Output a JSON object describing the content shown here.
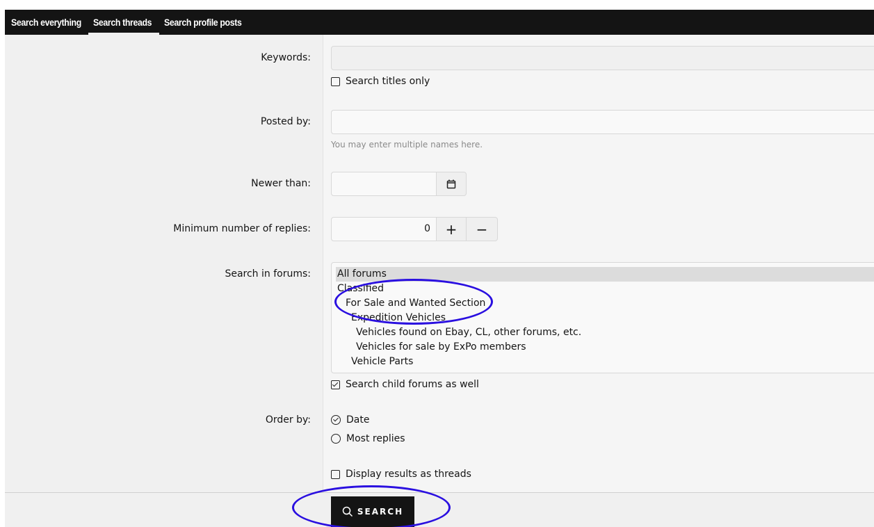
{
  "tabs": [
    {
      "label": "Search everything",
      "active": false
    },
    {
      "label": "Search threads",
      "active": true
    },
    {
      "label": "Search profile posts",
      "active": false
    }
  ],
  "form": {
    "keywords": {
      "label": "Keywords:",
      "value": "",
      "titles_only": {
        "label": "Search titles only",
        "checked": false
      }
    },
    "posted_by": {
      "label": "Posted by:",
      "value": "",
      "hint": "You may enter multiple names here."
    },
    "newer_than": {
      "label": "Newer than:",
      "value": "",
      "icon": "calendar-icon"
    },
    "min_replies": {
      "label": "Minimum number of replies:",
      "value": "0",
      "plus": "+",
      "minus": "−"
    },
    "forums": {
      "label": "Search in forums:",
      "options": [
        {
          "label": "All forums",
          "selected": true
        },
        {
          "label": "Classified",
          "selected": false
        },
        {
          "label": "For Sale and Wanted Section",
          "selected": false
        },
        {
          "label": "Expedition Vehicles",
          "selected": false
        },
        {
          "label": "Vehicles found on Ebay, CL, other forums, etc.",
          "selected": false
        },
        {
          "label": "Vehicles for sale by ExPo members",
          "selected": false
        },
        {
          "label": "Vehicle Parts",
          "selected": false
        }
      ],
      "child_forums": {
        "label": "Search child forums as well",
        "checked": true
      }
    },
    "order_by": {
      "label": "Order by:",
      "options": [
        {
          "label": "Date",
          "checked": true
        },
        {
          "label": "Most replies",
          "checked": false
        }
      ]
    },
    "display_as_threads": {
      "label": "Display results as threads",
      "checked": false
    }
  },
  "search_button": {
    "label": "SEARCH",
    "icon": "search-icon"
  },
  "annotations": {
    "color": "#2a0fe0"
  }
}
